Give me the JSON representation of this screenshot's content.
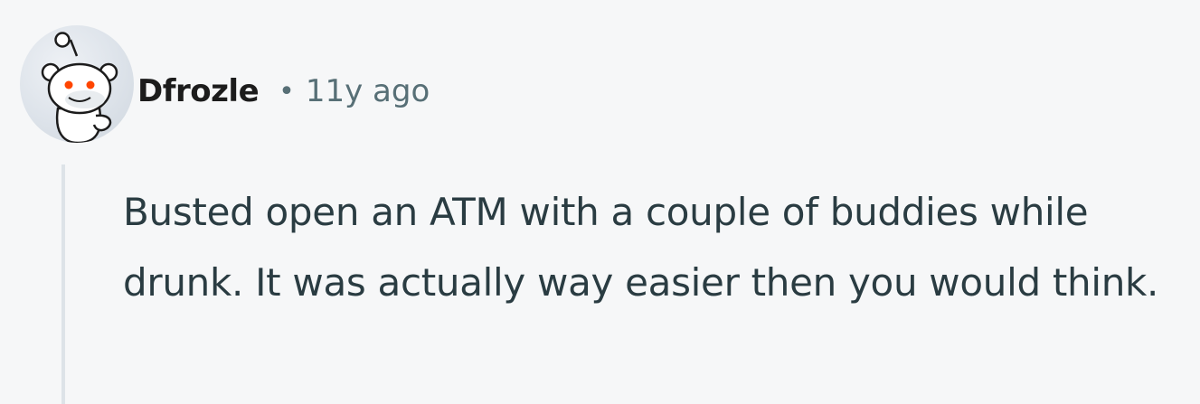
{
  "comment": {
    "author": "Dfrozle",
    "separator": "•",
    "timestamp": "11y ago",
    "body": "Busted open an ATM with a couple of buddies while drunk. It was actually way easier then you would think.",
    "avatar_icon": "snoo-avatar-icon"
  },
  "colors": {
    "background": "#f6f7f8",
    "username": "#1c1c1c",
    "meta": "#576f76",
    "body_text": "#2a3c42",
    "thread_line": "#dde3e8"
  }
}
